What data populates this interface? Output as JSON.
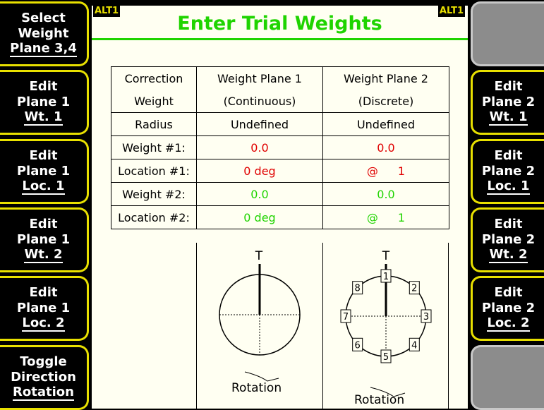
{
  "title": "Enter Trial Weights",
  "alt_left": "ALT1",
  "alt_right": "ALT1",
  "left_softkeys": [
    {
      "lines": [
        "Select",
        "Weight",
        "Plane 3,4"
      ]
    },
    {
      "lines": [
        "Edit",
        "Plane 1",
        "Wt. 1"
      ]
    },
    {
      "lines": [
        "Edit",
        "Plane 1",
        "Loc. 1"
      ]
    },
    {
      "lines": [
        "Edit",
        "Plane 1",
        "Wt. 2"
      ]
    },
    {
      "lines": [
        "Edit",
        "Plane 1",
        "Loc. 2"
      ]
    },
    {
      "lines": [
        "Toggle",
        "Direction",
        "Rotation"
      ]
    }
  ],
  "right_softkeys": [
    {
      "lines": []
    },
    {
      "lines": [
        "Edit",
        "Plane 2",
        "Wt. 1"
      ]
    },
    {
      "lines": [
        "Edit",
        "Plane 2",
        "Loc. 1"
      ]
    },
    {
      "lines": [
        "Edit",
        "Plane 2",
        "Wt. 2"
      ]
    },
    {
      "lines": [
        "Edit",
        "Plane 2",
        "Loc. 2"
      ]
    },
    {
      "lines": []
    }
  ],
  "table": {
    "header_row1": [
      "Correction",
      "Weight Plane 1",
      "Weight Plane 2"
    ],
    "header_row2": [
      "Weight",
      "(Continuous)",
      "(Discrete)"
    ],
    "radius": [
      "Radius",
      "Undefined",
      "Undefined"
    ],
    "weight1": {
      "label": "Weight #1:",
      "p1": "0.0",
      "p2": "0.0"
    },
    "location1": {
      "label": "Location #1:",
      "p1": "0 deg",
      "p2_at": "@",
      "p2_val": "1"
    },
    "weight2": {
      "label": "Weight #2:",
      "p1": "0.0",
      "p2": "0.0"
    },
    "location2": {
      "label": "Location #2:",
      "p1": "0 deg",
      "p2_at": "@",
      "p2_val": "1"
    }
  },
  "diagram": {
    "top_marker": "T",
    "positions": [
      "1",
      "2",
      "3",
      "4",
      "5",
      "6",
      "7",
      "8"
    ],
    "rotation_label": "Rotation"
  },
  "colors": {
    "title": "#1fd400",
    "softkey_border": "#e8e000",
    "red_value": "#e00000",
    "green_value": "#1fd400",
    "panel_bg": "#fffff2"
  }
}
